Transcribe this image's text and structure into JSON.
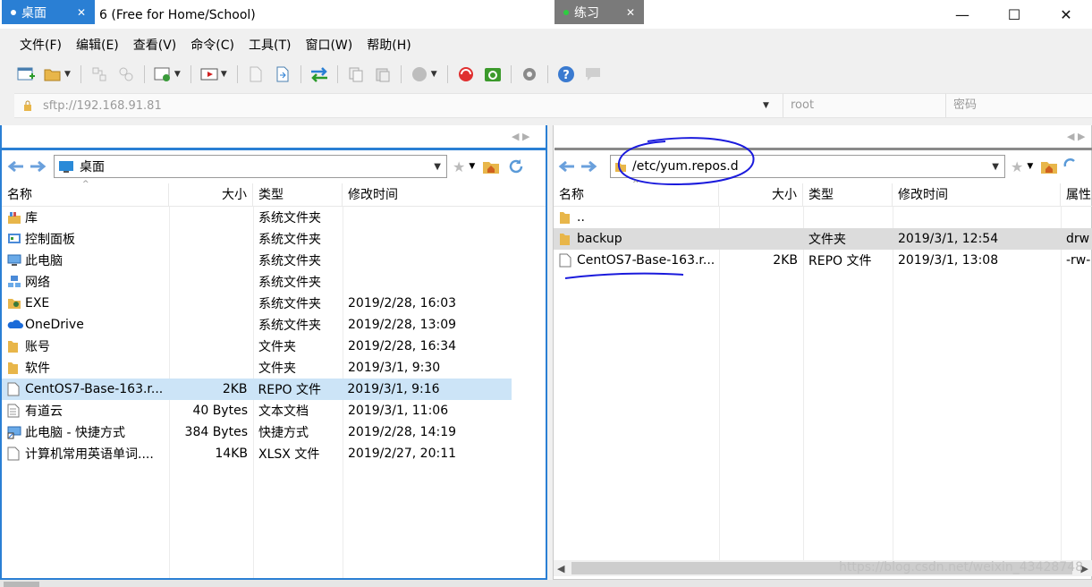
{
  "window": {
    "title": "桌面 - Xftp 6 (Free for Home/School)",
    "app_icon_text": "X",
    "minimize": "—",
    "maximize": "☐",
    "close": "✕"
  },
  "menu": [
    "文件(F)",
    "编辑(E)",
    "查看(V)",
    "命令(C)",
    "工具(T)",
    "窗口(W)",
    "帮助(H)"
  ],
  "address": {
    "host": "sftp://192.168.91.81",
    "user_placeholder": "root",
    "password_placeholder": "密码"
  },
  "left_pane": {
    "tab_label": "桌面",
    "path": "桌面",
    "columns": [
      "名称",
      "大小",
      "类型",
      "修改时间"
    ],
    "rows": [
      {
        "name": "库",
        "size": "",
        "type": "系统文件夹",
        "modified": "",
        "icon": "library-icon"
      },
      {
        "name": "控制面板",
        "size": "",
        "type": "系统文件夹",
        "modified": "",
        "icon": "control-panel-icon"
      },
      {
        "name": "此电脑",
        "size": "",
        "type": "系统文件夹",
        "modified": "",
        "icon": "computer-icon"
      },
      {
        "name": "网络",
        "size": "",
        "type": "系统文件夹",
        "modified": "",
        "icon": "network-icon"
      },
      {
        "name": "EXE",
        "size": "",
        "type": "系统文件夹",
        "modified": "2019/2/28, 16:03",
        "icon": "user-folder-icon"
      },
      {
        "name": "OneDrive",
        "size": "",
        "type": "系统文件夹",
        "modified": "2019/2/28, 13:09",
        "icon": "onedrive-icon"
      },
      {
        "name": "账号",
        "size": "",
        "type": "文件夹",
        "modified": "2019/2/28, 16:34",
        "icon": "folder-icon"
      },
      {
        "name": "软件",
        "size": "",
        "type": "文件夹",
        "modified": "2019/3/1, 9:30",
        "icon": "folder-icon"
      },
      {
        "name": "CentOS7-Base-163.r...",
        "size": "2KB",
        "type": "REPO 文件",
        "modified": "2019/3/1, 9:16",
        "icon": "file-icon",
        "selected": true
      },
      {
        "name": "有道云",
        "size": "40 Bytes",
        "type": "文本文档",
        "modified": "2019/3/1, 11:06",
        "icon": "text-file-icon"
      },
      {
        "name": "此电脑 - 快捷方式",
        "size": "384 Bytes",
        "type": "快捷方式",
        "modified": "2019/2/28, 14:19",
        "icon": "shortcut-icon"
      },
      {
        "name": "计算机常用英语单词....",
        "size": "14KB",
        "type": "XLSX 文件",
        "modified": "2019/2/27, 20:11",
        "icon": "file-icon"
      }
    ]
  },
  "right_pane": {
    "tab_label": "练习",
    "path": "/etc/yum.repos.d",
    "columns": [
      "名称",
      "大小",
      "类型",
      "修改时间",
      "属性"
    ],
    "rows": [
      {
        "name": "..",
        "size": "",
        "type": "",
        "modified": "",
        "attr": "",
        "icon": "folder-icon"
      },
      {
        "name": "backup",
        "size": "",
        "type": "文件夹",
        "modified": "2019/3/1, 12:54",
        "attr": "drw",
        "icon": "folder-icon",
        "highlight": true
      },
      {
        "name": "CentOS7-Base-163.r...",
        "size": "2KB",
        "type": "REPO 文件",
        "modified": "2019/3/1, 13:08",
        "attr": "-rw-",
        "icon": "file-icon"
      }
    ]
  },
  "watermark": "https://blog.csdn.net/weixin_43428748",
  "colors": {
    "accent": "#2a7fd4",
    "selected_row": "#cce4f7",
    "annotation_ink": "#1a1adc"
  }
}
